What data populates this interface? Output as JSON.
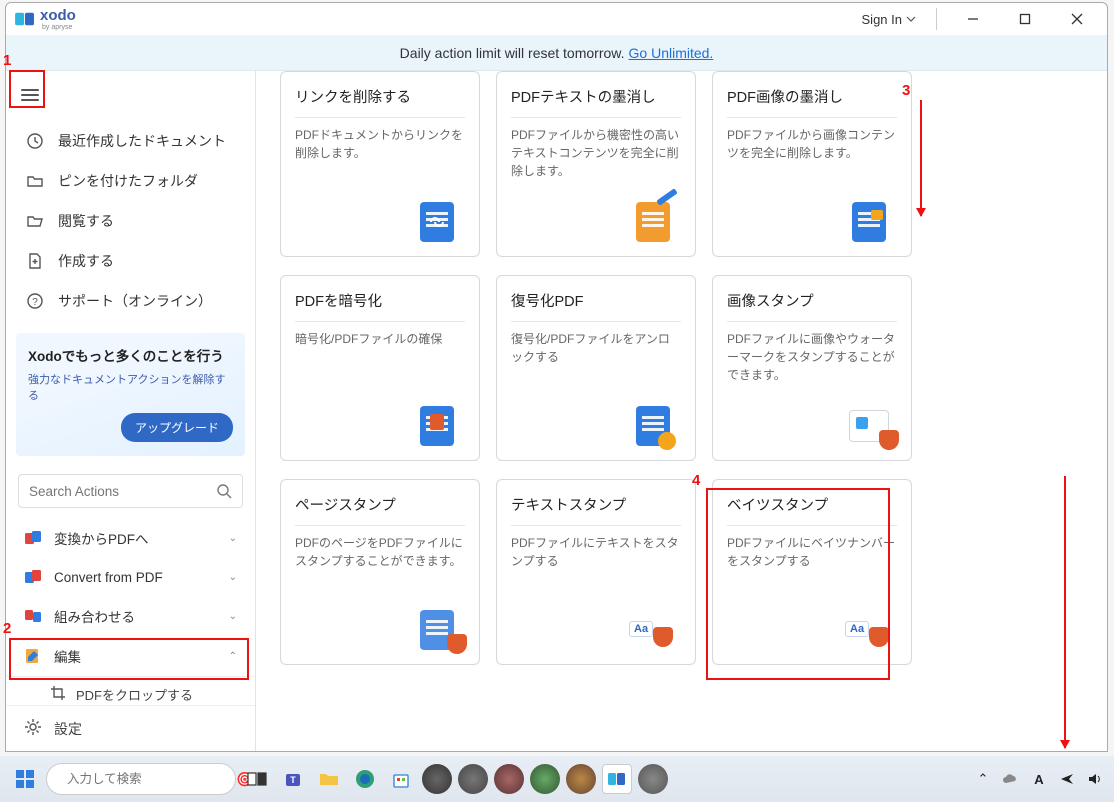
{
  "app": {
    "name": "xodo",
    "byline": "by apryse"
  },
  "titlebar": {
    "signin": "Sign In"
  },
  "banner": {
    "text": "Daily action limit will reset tomorrow.",
    "link": "Go Unlimited."
  },
  "sidebar": {
    "nav": [
      {
        "label": "最近作成したドキュメント",
        "icon": "clock"
      },
      {
        "label": "ピンを付けたフォルダ",
        "icon": "folder-pin"
      },
      {
        "label": "閲覧する",
        "icon": "folder-open"
      },
      {
        "label": "作成する",
        "icon": "file-plus"
      },
      {
        "label": "サポート（オンライン）",
        "icon": "help"
      }
    ],
    "promo": {
      "title": "Xodoでもっと多くのことを行う",
      "subtitle": "強力なドキュメントアクションを解除する",
      "button": "アップグレード"
    },
    "search_placeholder": "Search Actions",
    "categories": [
      {
        "label": "変換からPDFへ",
        "expanded": false,
        "color": "#e0443a"
      },
      {
        "label": "Convert from PDF",
        "expanded": false,
        "color": "#2f7de1"
      },
      {
        "label": "組み合わせる",
        "expanded": false,
        "color": "#e0443a"
      },
      {
        "label": "編集",
        "expanded": true,
        "color": "#f2a93b"
      }
    ],
    "sub_item": "PDFをクロップする",
    "settings": "設定"
  },
  "cards": [
    {
      "title": "リンクを削除する",
      "desc": "PDFドキュメントからリンクを削除します。"
    },
    {
      "title": "PDFテキストの墨消し",
      "desc": "PDFファイルから機密性の高いテキストコンテンツを完全に削除します。"
    },
    {
      "title": "PDF画像の墨消し",
      "desc": "PDFファイルから画像コンテンツを完全に削除します。"
    },
    {
      "title": "PDFを暗号化",
      "desc": "暗号化/PDFファイルの確保"
    },
    {
      "title": "復号化PDF",
      "desc": "復号化/PDFファイルをアンロックする"
    },
    {
      "title": "画像スタンプ",
      "desc": "PDFファイルに画像やウォーターマークをスタンプすることができます。"
    },
    {
      "title": "ページスタンプ",
      "desc": "PDFのページをPDFファイルにスタンプすることができます。"
    },
    {
      "title": "テキストスタンプ",
      "desc": "PDFファイルにテキストをスタンプする"
    },
    {
      "title": "ベイツスタンプ",
      "desc": "PDFファイルにベイツナンバーをスタンプする"
    }
  ],
  "annotations": {
    "a1": "1",
    "a2": "2",
    "a3": "3",
    "a4": "4"
  },
  "taskbar": {
    "search_placeholder": "入力して検索"
  }
}
